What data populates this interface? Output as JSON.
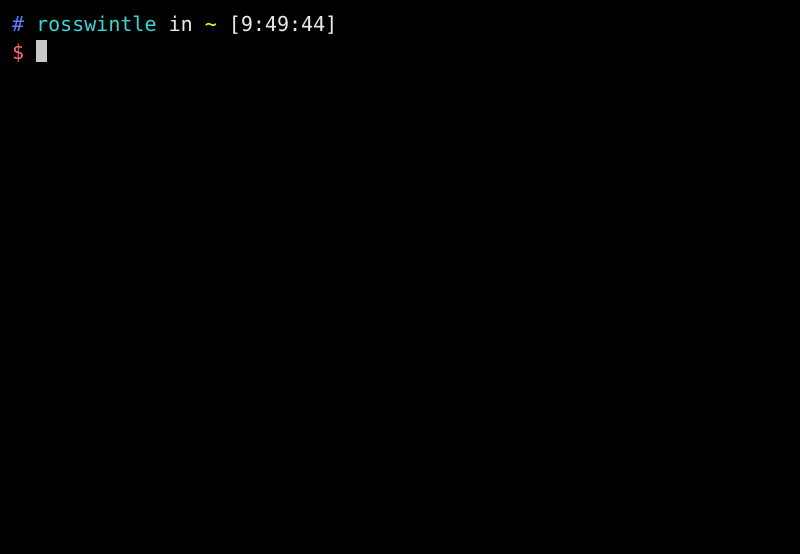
{
  "prompt": {
    "hash": "#",
    "username": "rosswintle",
    "in_word": "in",
    "path": "~",
    "timestamp": "[9:49:44]",
    "dollar": "$"
  },
  "command": ""
}
